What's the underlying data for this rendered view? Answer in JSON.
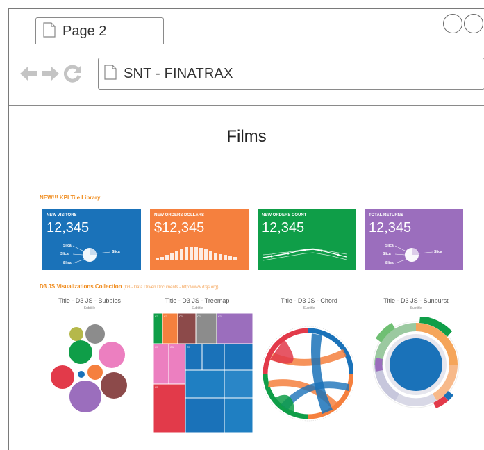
{
  "browser": {
    "tab_title": "Page 2",
    "address": "SNT - FINATRAX"
  },
  "page": {
    "title": "Films"
  },
  "kpi_section": {
    "heading": "NEW!!! KPI Tile Library",
    "tiles": [
      {
        "label": "NEW VISITORS",
        "value": "12,345",
        "color": "#1a72b9",
        "legend": [
          "Slica",
          "Slica",
          "Slica",
          "Slica"
        ]
      },
      {
        "label": "NEW ORDERS DOLLARS",
        "value": "$12,345",
        "color": "#f5803e"
      },
      {
        "label": "NEW ORDERS COUNT",
        "value": "12,345",
        "color": "#0f9e48"
      },
      {
        "label": "TOTAL RETURNS",
        "value": "12,345",
        "color": "#9b6ebd",
        "legend": [
          "Slica",
          "Slica",
          "Slica",
          "Slica"
        ]
      }
    ]
  },
  "viz_section": {
    "heading": "D3 JS Visualizations Collection",
    "subheading": "(D3 - Data Driven Documents - http://www.d3js.org)",
    "items": [
      {
        "title": "Title - D3 JS - Bubbles",
        "subtitle": "Subtitle"
      },
      {
        "title": "Title - D3 JS - Treemap",
        "subtitle": "Subtitle"
      },
      {
        "title": "Title - D3 JS - Chord",
        "subtitle": "Subtitle"
      },
      {
        "title": "Title - D3 JS - Sunburst",
        "subtitle": "Subtitle"
      }
    ],
    "treemap_labels": [
      "C1",
      "C1",
      "C1",
      "C1",
      "C1",
      "C1",
      "C1",
      "C1",
      "C1"
    ]
  },
  "colors": {
    "blue": "#1a72b9",
    "orange": "#f5803e",
    "green": "#0f9e48",
    "purple": "#9b6ebd",
    "red": "#e23a4a",
    "accent_orange": "#f08c1e"
  }
}
